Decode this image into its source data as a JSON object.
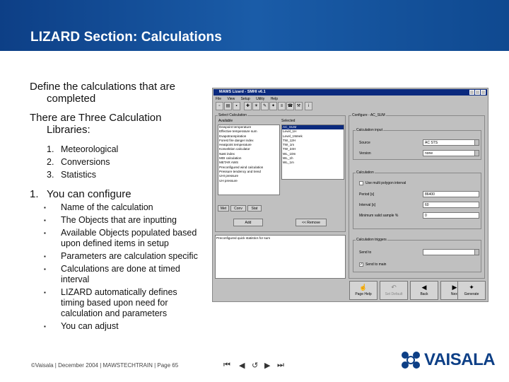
{
  "header": {
    "title": "LIZARD Section: Calculations",
    "bg_color": "#1a5ca8"
  },
  "content": {
    "para1": "Define the calculations that are completed",
    "para2": "There are Three Calculation Libraries:",
    "libraries": [
      {
        "num": "1.",
        "label": "Meteorological"
      },
      {
        "num": "2.",
        "label": "Conversions"
      },
      {
        "num": "3.",
        "label": "Statistics"
      }
    ],
    "configure_num": "1.",
    "configure_label": "You can configure",
    "bullets": [
      "Name of the calculation",
      "The Objects that are inputting",
      "Available Objects populated based upon defined items in setup",
      "Parameters are calculation specific",
      "Calculations are done at timed interval",
      "LIZARD automatically defines timing based upon need for calculation and parameters",
      "You can adjust"
    ]
  },
  "footer": {
    "text": "©Vaisala | December 2004 | MAWSTECHTRAIN | Page 65"
  },
  "nav": {
    "first": "⏮",
    "prev": "◀",
    "back": "↺",
    "next": "▶",
    "last": "⏭"
  },
  "logo": {
    "text": "VAISALA",
    "color": "#0d3f86"
  },
  "window": {
    "title": "MAWS Lizard - SMHI v6.1",
    "menu": [
      "File",
      "View",
      "Setup",
      "Utility",
      "Help"
    ],
    "select_panel_label": "Select Calculation",
    "available_label": "Available",
    "selected_label": "Selected",
    "available_items": [
      "Dewpoint temperature",
      "Effective temperature sum",
      "Evapotranspiration",
      "Forest fire danger index",
      "Heatpoint temperature",
      "Konvektion calculator",
      "Nøst index",
      "MDI calculation",
      "METAR AWS",
      "Preconfigured wind calculation",
      "Pressure tendency and trend",
      "UHI pressure",
      "UH pressure"
    ],
    "selected_items": [
      "AC_SUM",
      "Level_1H",
      "Level_1Week",
      "TW_12H",
      "TW_1m",
      "TW_24H",
      "WL_10m",
      "WL_1h",
      "WL_1m"
    ],
    "lib_tabs": [
      "Met",
      "Conv",
      "Stat"
    ],
    "add_button": "Add",
    "remove_button": "<< Remove",
    "description": "Preconfigured quick statistics for sum",
    "config_panel_label": "Configure - AC_SUM",
    "calc_input_label": "Calculation input",
    "source_label": "Source",
    "source_value": "AC STS",
    "version_label": "Version",
    "version_value": "none",
    "calculation_label": "Calculation",
    "use_polygon_label": "Use multi polygon interval",
    "period_label": "Period [s]",
    "period_value": "86400",
    "interval_label": "Interval [s]",
    "interval_value": "60",
    "min_valid_label": "Minimum valid sample %",
    "min_valid_value": "0",
    "triggers_label": "Calculation triggers",
    "send_to_label": "Send to",
    "send_to_value": "",
    "send_to_check_label": "Send to main",
    "bottom_buttons": [
      {
        "label": "Page Help",
        "icon": "☝"
      },
      {
        "label": "Set Default",
        "icon": "↶"
      },
      {
        "label": "Back",
        "icon": "◀"
      },
      {
        "label": "Next",
        "icon": "▶"
      },
      {
        "label": "Generate",
        "icon": "✦"
      }
    ]
  }
}
